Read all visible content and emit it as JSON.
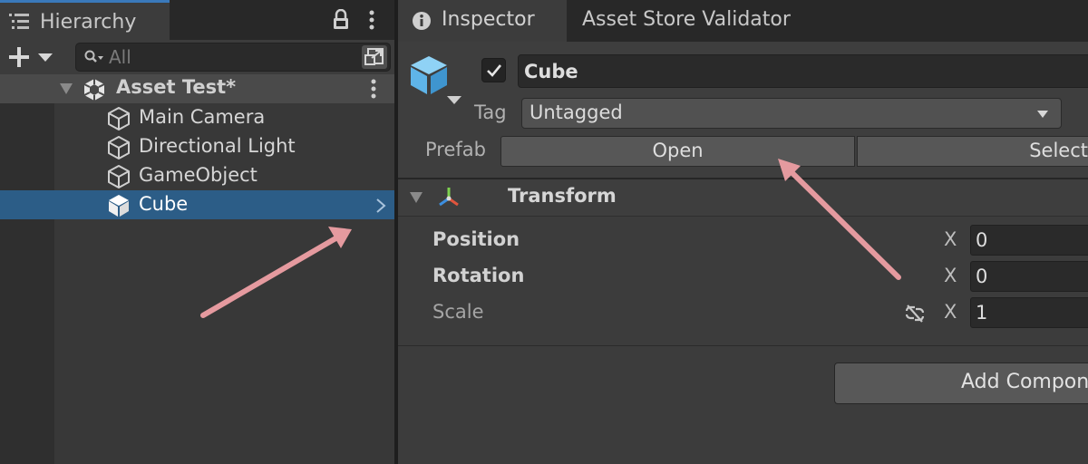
{
  "hierarchy": {
    "tab_label": "Hierarchy",
    "tab_icon": "list-icon",
    "search": {
      "placeholder": "All",
      "value": ""
    },
    "scene": {
      "name": "Asset Test*",
      "icon": "unity-scene-icon"
    },
    "items": [
      {
        "label": "Main Camera",
        "icon": "gameobject-icon",
        "selected": false
      },
      {
        "label": "Directional Light",
        "icon": "gameobject-icon",
        "selected": false
      },
      {
        "label": "GameObject",
        "icon": "gameobject-icon",
        "selected": false
      },
      {
        "label": "Cube",
        "icon": "prefab-cube-icon",
        "selected": true
      }
    ]
  },
  "inspector": {
    "tab_label": "Inspector",
    "other_tab_label": "Asset Store Validator",
    "object": {
      "name": "Cube",
      "active": true,
      "tag_label": "Tag",
      "tag_value": "Untagged",
      "prefab_label": "Prefab",
      "prefab_open": "Open",
      "prefab_select": "Select"
    },
    "transform": {
      "title": "Transform",
      "rows": [
        {
          "label": "Position",
          "axis": "X",
          "x": "0"
        },
        {
          "label": "Rotation",
          "axis": "X",
          "x": "0"
        },
        {
          "label": "Scale",
          "axis": "X",
          "x": "1"
        }
      ]
    },
    "add_component_label": "Add Component"
  },
  "colors": {
    "selection": "#2c5d87",
    "tab_accent": "#3a79bb",
    "prefab_blue": "#5fb4e8",
    "annotation_arrow": "#e59a9f"
  }
}
